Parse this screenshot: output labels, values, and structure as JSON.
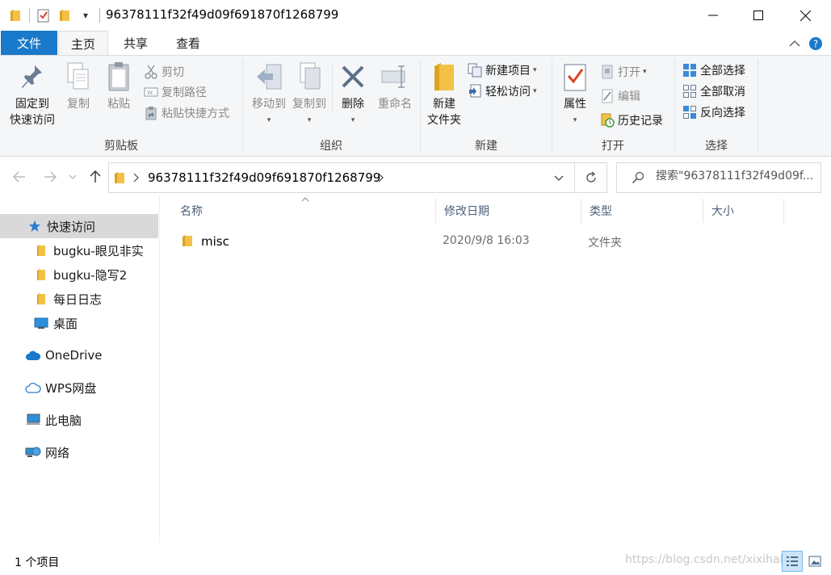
{
  "window": {
    "title": "96378111f32f49d09f691870f1268799",
    "qat_dropdown": "▾"
  },
  "tabs": [
    {
      "label": "文件"
    },
    {
      "label": "主页"
    },
    {
      "label": "共享"
    },
    {
      "label": "查看"
    }
  ],
  "ribbon": {
    "clipboard": {
      "label": "剪贴板",
      "pin_line1": "固定到",
      "pin_line2": "快速访问",
      "copy": "复制",
      "paste": "粘贴",
      "cut": "剪切",
      "copy_path": "复制路径",
      "paste_shortcut": "粘贴快捷方式"
    },
    "organize": {
      "label": "组织",
      "move_to": "移动到",
      "copy_to": "复制到",
      "delete": "删除",
      "rename": "重命名"
    },
    "new": {
      "label": "新建",
      "new_folder_line1": "新建",
      "new_folder_line2": "文件夹",
      "new_item": "新建项目",
      "easy_access": "轻松访问"
    },
    "open": {
      "label": "打开",
      "properties": "属性",
      "open": "打开",
      "edit": "编辑",
      "history": "历史记录"
    },
    "select": {
      "label": "选择",
      "select_all": "全部选择",
      "select_none": "全部取消",
      "invert": "反向选择"
    }
  },
  "address": {
    "path": "96378111f32f49d09f691870f1268799",
    "search_placeholder": "搜索\"96378111f32f49d09f..."
  },
  "navpane": {
    "quick_access": "快速访问",
    "items": [
      {
        "label": "bugku-眼见非实"
      },
      {
        "label": "bugku-隐写2"
      },
      {
        "label": "每日日志"
      },
      {
        "label": "桌面"
      }
    ],
    "onedrive": "OneDrive",
    "wps": "WPS网盘",
    "this_pc": "此电脑",
    "network": "网络"
  },
  "filelist": {
    "columns": {
      "name": "名称",
      "modified": "修改日期",
      "type": "类型",
      "size": "大小"
    },
    "rows": [
      {
        "name": "misc",
        "modified": "2020/9/8 16:03",
        "type": "文件夹",
        "size": ""
      }
    ]
  },
  "statusbar": {
    "count": "1 个项目",
    "watermark": "https://blog.csdn.net/xixihah"
  },
  "colors": {
    "accent": "#1979ca",
    "folder": "#f4c146",
    "ribbon_bg": "#f5f6f7"
  }
}
